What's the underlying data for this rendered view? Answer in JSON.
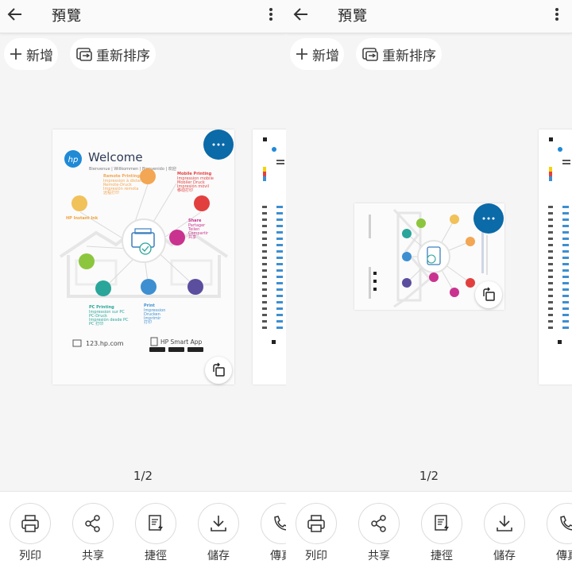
{
  "app": {
    "title": "預覽",
    "add_label": "新增",
    "reorder_label": "重新排序",
    "page_counter": "1/2"
  },
  "actions": [
    {
      "label": "列印",
      "icon": "printer-icon"
    },
    {
      "label": "共享",
      "icon": "share-icon"
    },
    {
      "label": "捷徑",
      "icon": "shortcut-icon"
    },
    {
      "label": "儲存",
      "icon": "download-icon"
    },
    {
      "label": "傳真",
      "icon": "fax-icon"
    }
  ],
  "document": {
    "heading": "Welcome",
    "languages": "Bienvenue | Willkommen | Bienvenido | 欢迎",
    "features": [
      {
        "title": "Remote Printing",
        "lines": [
          "Impression à distance",
          "Remote-Druck",
          "Impresión remota",
          "远程打印"
        ]
      },
      {
        "title": "Mobile Printing",
        "lines": [
          "Impression mobile",
          "Mobiler Druck",
          "Impresión móvil",
          "移动打印"
        ]
      },
      {
        "title": "HP Instant Ink",
        "lines": []
      },
      {
        "title": "Share",
        "lines": [
          "Partager",
          "Teilen",
          "Compartir",
          "共享"
        ]
      },
      {
        "title": "PC Printing",
        "lines": [
          "Impression sur PC",
          "PC-Druck",
          "Impresión desde PC",
          "PC 打印"
        ]
      },
      {
        "title": "Print",
        "lines": [
          "Impression",
          "Drucken",
          "Imprimir",
          "打印"
        ]
      }
    ],
    "url": "123.hp.com",
    "app_name": "HP Smart App",
    "logo_text": "hp"
  },
  "colors": {
    "accent": "#0b6aa8",
    "orange": "#f3a653",
    "yellow": "#f1c15a",
    "magenta": "#c9338f",
    "green": "#8cc63f",
    "teal": "#2aa59a",
    "blue": "#3d8fd1",
    "purple": "#5b4e9e",
    "red": "#e2403f"
  }
}
